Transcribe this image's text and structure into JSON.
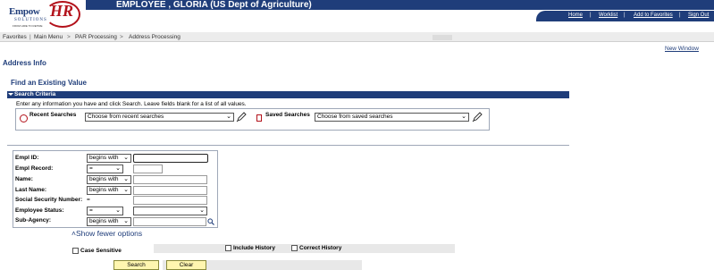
{
  "header": {
    "employee_name": "EMPLOYEE , GLORIA (US Dept of Agriculture)",
    "logo": {
      "text1": "Empow",
      "text2": "HR",
      "sub": "SOLUTIONS",
      "tag": "FROM HIRE TO RETIRE"
    },
    "links": [
      "Home",
      "Worklist",
      "Add to Favorites",
      "Sign Out"
    ]
  },
  "breadcrumb": {
    "items": [
      "Favorites",
      "Main Menu",
      "PAR Processing",
      "Address Processing"
    ],
    "separator": "|",
    "arrow": ">"
  },
  "new_window_link": "New Window",
  "page_title": "Address Info",
  "subtitle": "Find an Existing Value",
  "section": {
    "title": "Search Criteria",
    "instructions": "Enter any information you have and click Search. Leave fields blank for a list of all values."
  },
  "searches": {
    "recent_label": "Recent Searches",
    "recent_value": "Choose from recent searches",
    "saved_label": "Saved Searches",
    "saved_value": "Choose from saved searches"
  },
  "criteria": [
    {
      "label": "Empl ID:",
      "operator": "begins with",
      "value": ""
    },
    {
      "label": "Empl Record:",
      "operator": "=",
      "value": ""
    },
    {
      "label": "Name:",
      "operator": "begins with",
      "value": ""
    },
    {
      "label": "Last Name:",
      "operator": "begins with",
      "value": ""
    },
    {
      "label": "Social Security Number:",
      "operator": "=",
      "value": ""
    },
    {
      "label": "Employee Status:",
      "operator": "=",
      "value": ""
    },
    {
      "label": "Sub-Agency:",
      "operator": "begins with",
      "value": ""
    }
  ],
  "show_fewer": "Show fewer options",
  "checkboxes": {
    "case_sensitive": "Case Sensitive",
    "include_history": "Include History",
    "correct_history": "Correct History"
  },
  "buttons": {
    "search": "Search",
    "clear": "Clear"
  },
  "colors": {
    "brand_navy": "#1f3d7a",
    "brand_red": "#b3121b",
    "button_yellow": "#fff6b0"
  }
}
